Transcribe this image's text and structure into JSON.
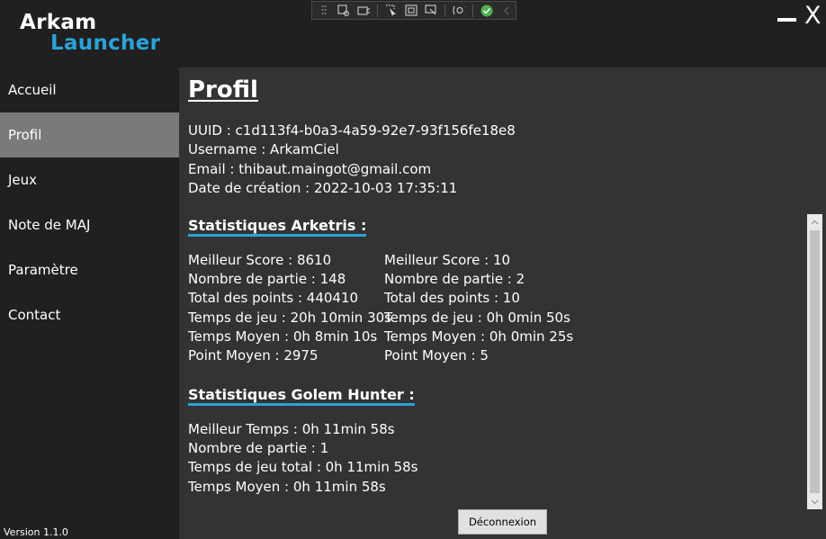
{
  "app": {
    "logo_line1": "Arkam",
    "logo_line2": "Launcher",
    "close_label": "X",
    "version": "Version 1.1.0"
  },
  "sidebar": {
    "items": [
      "Accueil",
      "Profil",
      "Jeux",
      "Note de MAJ",
      "Paramètre",
      "Contact"
    ],
    "active": "Profil"
  },
  "profile": {
    "title": "Profil",
    "uuid": "UUID : c1d113f4-b0a3-4a59-92e7-93f156fe18e8",
    "username": "Username : ArkamCiel",
    "email": "Email : thibaut.maingot@gmail.com",
    "created": "Date de création : 2022-10-03 17:35:11"
  },
  "arketris": {
    "title": "Statistiques Arketris :",
    "col1": [
      "Meilleur Score : 8610",
      "Nombre de partie : 148",
      "Total des points : 440410",
      "Temps de jeu : 20h 10min 30s",
      "Temps Moyen : 0h 8min 10s",
      "Point Moyen : 2975"
    ],
    "col2": [
      "Meilleur Score : 10",
      "Nombre de partie : 2",
      "Total des points : 10",
      "Temps de jeu : 0h 0min 50s",
      "Temps Moyen : 0h 0min 25s",
      "Point Moyen : 5"
    ]
  },
  "golem": {
    "title": "Statistiques Golem Hunter :",
    "lines": [
      "Meilleur Temps : 0h 11min 58s",
      "Nombre de partie : 1",
      "Temps de jeu total : 0h 11min 58s",
      "Temps Moyen : 0h 11min 58s"
    ]
  },
  "buttons": {
    "logout": "Déconnexion"
  },
  "colors": {
    "accent": "#2aa3d8",
    "active_nav": "#7a7a7a",
    "sidebar_bg": "#202020",
    "content_bg": "#333333"
  }
}
